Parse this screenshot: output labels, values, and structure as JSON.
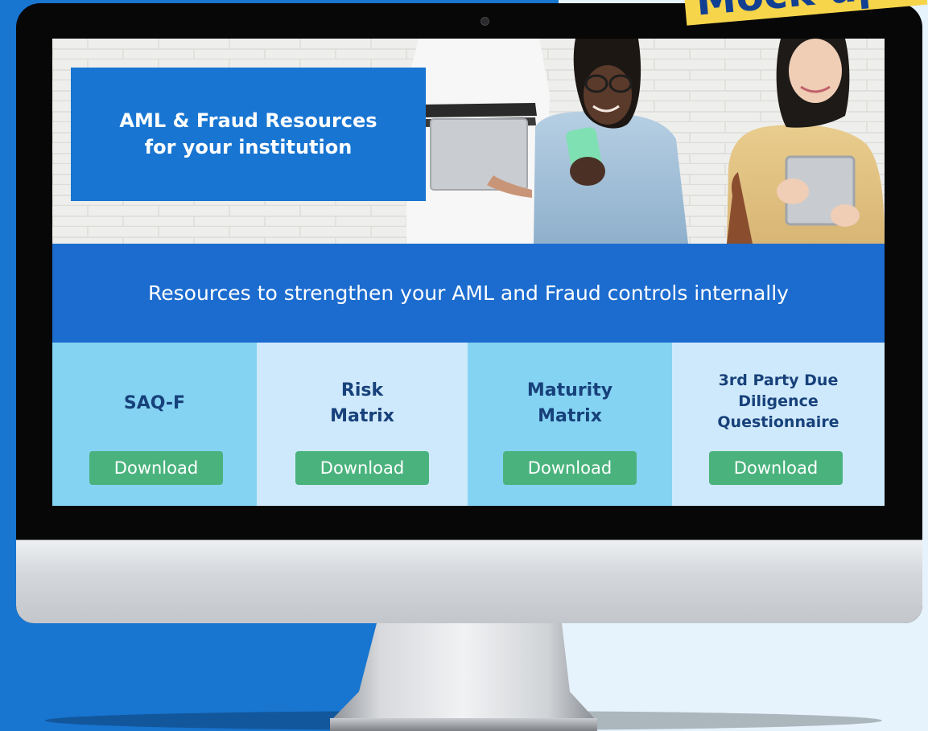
{
  "hero": {
    "title_line1": "AML & Fraud Resources",
    "title_line2": "for your institution"
  },
  "banner": {
    "text": "Resources to strengthen your AML and Fraud controls internally"
  },
  "cards": [
    {
      "title_lines": [
        "SAQ-F"
      ],
      "button_label": "Download",
      "background": "#85d3f3"
    },
    {
      "title_lines": [
        "Risk",
        "Matrix"
      ],
      "button_label": "Download",
      "background": "#cfe9fc"
    },
    {
      "title_lines": [
        "Maturity",
        "Matrix"
      ],
      "button_label": "Download",
      "background": "#85d3f3"
    },
    {
      "title_lines": [
        "3rd Party Due",
        "Diligence",
        "Questionnaire"
      ],
      "button_label": "Download",
      "background": "#cfe9fc"
    }
  ],
  "stamp": {
    "text": "Mock up"
  },
  "colors": {
    "brand_blue": "#1875d1",
    "banner_blue": "#1c6ccf",
    "download_green": "#4ab37d",
    "card_title_navy": "#17417a",
    "stamp_yellow": "#f7d54a"
  }
}
